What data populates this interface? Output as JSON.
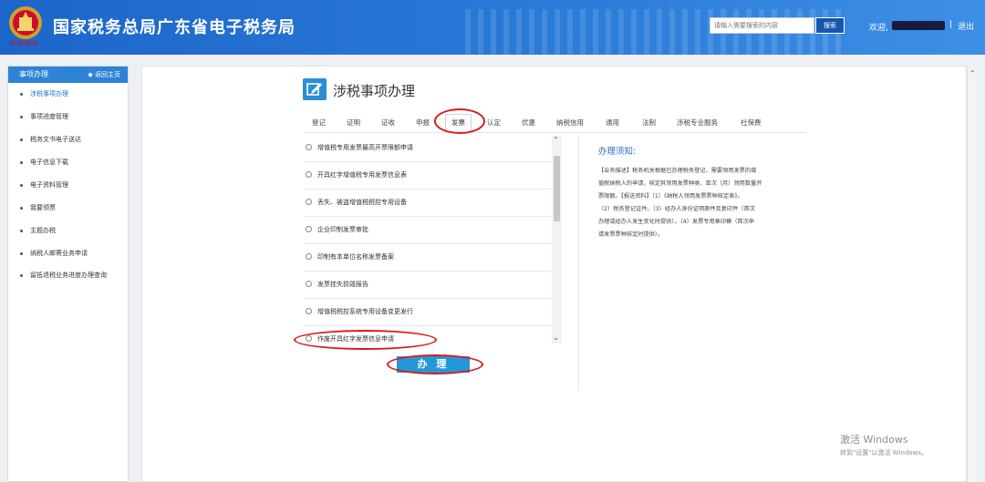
{
  "header": {
    "title": "国家税务总局广东省电子税务局",
    "brand_sub": "中国税务",
    "search_placeholder": "请输入需要搜索的内容",
    "search_button": "搜索",
    "welcome": "欢迎,",
    "separator": "|",
    "logout": "退出"
  },
  "sidebar": {
    "title": "事项办理",
    "back_home": "◆ 返回主页",
    "items": [
      {
        "label": "涉税事项办理"
      },
      {
        "label": "事项进度管理"
      },
      {
        "label": "税务文书电子送达"
      },
      {
        "label": "电子信息下载"
      },
      {
        "label": "电子资料管理"
      },
      {
        "label": "我要领票"
      },
      {
        "label": "主题办税"
      },
      {
        "label": "纳税人邮寄业务申请"
      },
      {
        "label": "留抵退税业务进度办理查询"
      }
    ]
  },
  "main": {
    "title": "涉税事项办理",
    "tabs": [
      {
        "label": "登记"
      },
      {
        "label": "证明"
      },
      {
        "label": "证收"
      },
      {
        "label": "申报"
      },
      {
        "label": "发票"
      },
      {
        "label": "认定"
      },
      {
        "label": "优惠"
      },
      {
        "label": "纳税信用"
      },
      {
        "label": "通用"
      },
      {
        "label": "法制"
      },
      {
        "label": "涉税专业服务"
      },
      {
        "label": "社保费"
      }
    ],
    "active_tab": "发票",
    "options": [
      {
        "label": "增值税专用发票最高开票限额申请"
      },
      {
        "label": "开具红字增值税专用发票信息表"
      },
      {
        "label": "丢失、被盗增值税税控专用设备"
      },
      {
        "label": "企业印制发票审批"
      },
      {
        "label": "印制有本单位名称发票备案"
      },
      {
        "label": "发票挂失损毁报告"
      },
      {
        "label": "增值税税控系统专用设备变更发行"
      },
      {
        "label": "作废开具红字发票信息申请"
      }
    ],
    "submit": "办 理",
    "notice_title": "办理须知:",
    "notice_lines": [
      "【业务描述】税务机关根据已办理税务登记、需要领用发票的增",
      "值税纳税人的申请，核定其领用发票种类、单次（月）领用数量开",
      "票限额。【报送资料】（1）《纳税人领用发票票种核定表》。",
      "（2）税务登记证件。（3）经办人身份证明原件及复印件（首次",
      "办理或经办人发生变化时提供）。（4）发票专用章印模（首次申",
      "请发票票种核定时提供）。"
    ]
  },
  "watermark": {
    "title": "激活 Windows",
    "subtitle": "转到\"设置\"以激活 Windows。"
  },
  "colors": {
    "header_blue": "#1c66c9",
    "accent": "#2497d6",
    "annotation_red": "#d81a1a"
  }
}
